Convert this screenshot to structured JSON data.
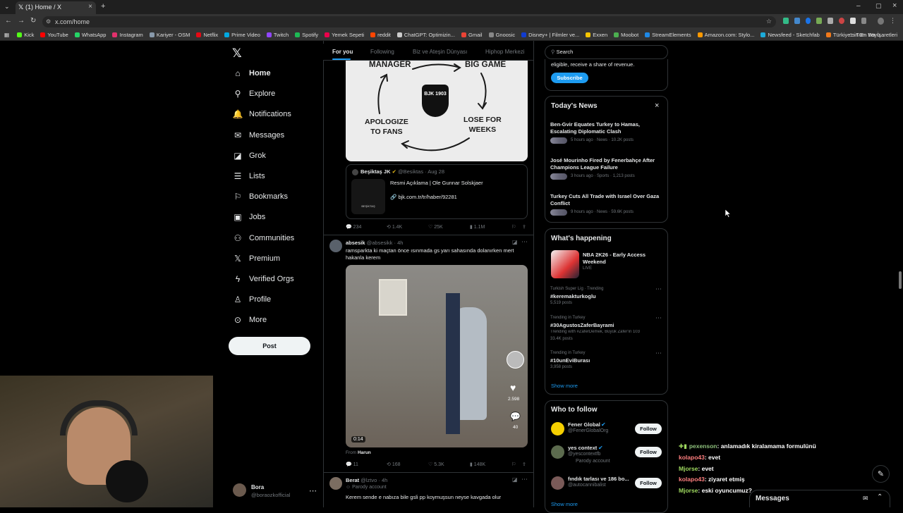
{
  "browser": {
    "tab_title": "(1) Home / X",
    "url": "x.com/home",
    "all_bookmarks": "Tüm Yer İşaretleri",
    "bookmarks": [
      {
        "label": "Kick",
        "color": "#53fc18"
      },
      {
        "label": "YouTube",
        "color": "#ff0000"
      },
      {
        "label": "WhatsApp",
        "color": "#25d366"
      },
      {
        "label": "Instagram",
        "color": "#e1306c"
      },
      {
        "label": "Kariyer - OSM",
        "color": "#8899aa"
      },
      {
        "label": "Netflix",
        "color": "#e50914"
      },
      {
        "label": "Prime Video",
        "color": "#00a8e1"
      },
      {
        "label": "Twitch",
        "color": "#9146ff"
      },
      {
        "label": "Spotify",
        "color": "#1db954"
      },
      {
        "label": "Yemek Sepeti",
        "color": "#ea004b"
      },
      {
        "label": "reddit",
        "color": "#ff4500"
      },
      {
        "label": "ChatGPT: Optimizin...",
        "color": "#cccccc"
      },
      {
        "label": "Gmail",
        "color": "#ea4335"
      },
      {
        "label": "Gnoosic",
        "color": "#888888"
      },
      {
        "label": "Disney+ | Filmler ve...",
        "color": "#113ccf"
      },
      {
        "label": "Exxen",
        "color": "#f7c500"
      },
      {
        "label": "Moobot",
        "color": "#4caf50"
      },
      {
        "label": "StreamElements",
        "color": "#1e88e5"
      },
      {
        "label": "Amazon.com: Stylo...",
        "color": "#ff9900"
      },
      {
        "label": "Newsfeed - Sketchfab",
        "color": "#1caad9"
      },
      {
        "label": "Türkiye'nin En Büyü...",
        "color": "#f27a1a"
      }
    ]
  },
  "nav": {
    "items": [
      {
        "label": "Home",
        "icon": "home-icon",
        "glyph": "⌂"
      },
      {
        "label": "Explore",
        "icon": "search-icon",
        "glyph": "⚲"
      },
      {
        "label": "Notifications",
        "icon": "bell-icon",
        "glyph": "🔔"
      },
      {
        "label": "Messages",
        "icon": "envelope-icon",
        "glyph": "✉"
      },
      {
        "label": "Grok",
        "icon": "grok-icon",
        "glyph": "◪"
      },
      {
        "label": "Lists",
        "icon": "list-icon",
        "glyph": "☰"
      },
      {
        "label": "Bookmarks",
        "icon": "bookmark-icon",
        "glyph": "⚐"
      },
      {
        "label": "Jobs",
        "icon": "briefcase-icon",
        "glyph": "▣"
      },
      {
        "label": "Communities",
        "icon": "people-icon",
        "glyph": "⚇"
      },
      {
        "label": "Premium",
        "icon": "x-logo-icon",
        "glyph": "𝕏"
      },
      {
        "label": "Verified Orgs",
        "icon": "lightning-icon",
        "glyph": "ϟ"
      },
      {
        "label": "Profile",
        "icon": "person-icon",
        "glyph": "♙"
      },
      {
        "label": "More",
        "icon": "more-circle-icon",
        "glyph": "⊙"
      }
    ],
    "post_label": "Post",
    "account": {
      "name": "Bora",
      "handle": "@boraozkofficial"
    }
  },
  "feed": {
    "tabs": [
      "For you",
      "Following",
      "Biz ve Ateşin Dünyası",
      "Hiphop Merkezi"
    ],
    "graphic": {
      "top_left": "MANAGER",
      "top_right": "BIG GAME",
      "left": "APOLOGIZE\nTO FANS",
      "right": "LOSE FOR\nWEEKS",
      "badge": "BJK 1903"
    },
    "quote": {
      "name": "Beşiktaş JK",
      "handle": "@Besiktas · Aug 28",
      "text": "Resmi Açıklama | Ole Gunnar Solskjaer",
      "link": "bjk.com.tr/tr/haber/92281",
      "thumb_text": "BEŞİKTAŞ"
    },
    "actions1": {
      "replies": "234",
      "reposts": "1.4K",
      "likes": "25K",
      "views": "1.1M"
    },
    "tweet2": {
      "name": "absesik",
      "handle": "@absesikk · 4h",
      "text": "ramsparkta ki maçtan önce ısınmada gs yarı sahasında dolanırken mert hakanla kerem",
      "duration": "0:14",
      "likes": "2.598",
      "comments": "40",
      "from_label": "From",
      "from_name": "Harun"
    },
    "actions2": {
      "replies": "11",
      "reposts": "168",
      "likes": "5.3K",
      "views": "148K"
    },
    "tweet3": {
      "name": "Berat",
      "handle": "@lztvo · 4h",
      "tag": "Parody account",
      "text": "Kerem sende  e nabıza bile gsli pp koymuşsun neyse kavgada olur"
    }
  },
  "right": {
    "search_placeholder": "Search",
    "premium_text": "eligible, receive a share of revenue.",
    "subscribe": "Subscribe",
    "news_title": "Today's News",
    "news": [
      {
        "title": "Ben-Gvir Equates Turkey to Hamas, Escalating Diplomatic Clash",
        "meta": "5 hours ago · News · 10.2K posts"
      },
      {
        "title": "José Mourinho Fired by Fenerbahçe After Champions League Failure",
        "meta": "3 hours ago · Sports · 1,213 posts"
      },
      {
        "title": "Turkey Cuts All Trade with Israel Over Gaza Conflict",
        "meta": "9 hours ago · News · 59.6K posts"
      }
    ],
    "happening_title": "What's happening",
    "featured": {
      "title": "NBA 2K26 - Early Access Weekend",
      "status": "LIVE"
    },
    "trends": [
      {
        "context": "Turkish Super Lig · Trending",
        "name": "#keremakturkoglu",
        "extra": "",
        "count": "5,519 posts"
      },
      {
        "context": "Trending in Turkey",
        "name": "#30AgustosZaferBayrami",
        "extra": "Trending with #ZaferDemek, Büyük Zafer'in 103",
        "count": "33.4K posts"
      },
      {
        "context": "Trending in Turkey",
        "name": "#10unEviBurası",
        "extra": "",
        "count": "3,958 posts"
      }
    ],
    "show_more": "Show more",
    "wtf_title": "Who to follow",
    "follow": [
      {
        "name": "Fener Global",
        "handle": "@FenerGlobalOrg",
        "tag": ""
      },
      {
        "name": "yes context",
        "handle": "@yescontextfb",
        "tag": "Parody account"
      },
      {
        "name": "fındık tarlası ve 186 bo...",
        "handle": "@autocannibalist",
        "tag": ""
      }
    ],
    "follow_label": "Follow",
    "show_more2": "Show more",
    "messages_label": "Messages"
  },
  "chat": [
    {
      "user": "pexenson",
      "msg": ": anlamadık kiralamama formulünü",
      "color": "#8ec07c"
    },
    {
      "user": "kolapo43",
      "msg": ": evet",
      "color": "#ff7f7f"
    },
    {
      "user": "Mjorse",
      "msg": ": evet",
      "color": "#9fd95f"
    },
    {
      "user": "kolapo43",
      "msg": ": ziyaret etmiş",
      "color": "#ff7f7f"
    },
    {
      "user": "Mjorse",
      "msg": ": eski oyuncumuz?",
      "color": "#9fd95f"
    }
  ]
}
